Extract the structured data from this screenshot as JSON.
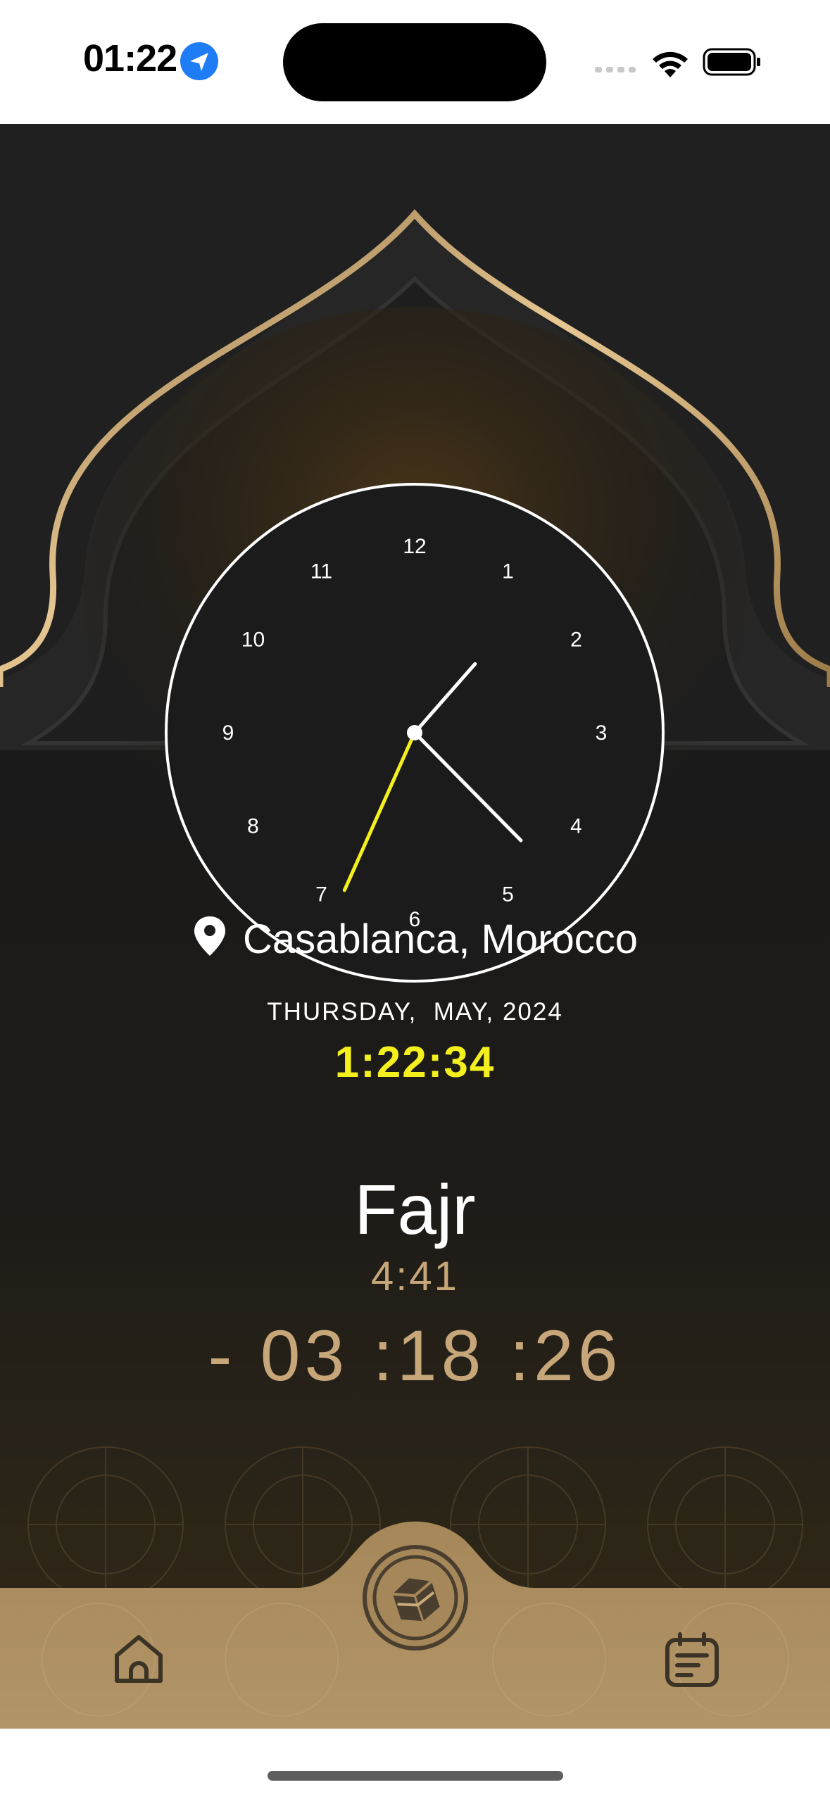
{
  "status_bar": {
    "time": "01:22",
    "icons": [
      "location-arrow-icon",
      "cellular-signal-icon",
      "wifi-icon",
      "battery-icon"
    ]
  },
  "clock": {
    "numerals": [
      "12",
      "1",
      "2",
      "3",
      "4",
      "5",
      "6",
      "7",
      "8",
      "9",
      "10",
      "11"
    ],
    "hour": 1,
    "minute": 22,
    "second": 34,
    "second_hand_color": "#f4f01e",
    "face_color": "#1b1b1b",
    "ring_color": "#ffffff"
  },
  "location": {
    "icon": "map-pin-icon",
    "label": "Casablanca, Morocco"
  },
  "date_line": "THURSDAY,  MAY, 2024",
  "current_time": "1:22:34",
  "next_prayer": {
    "name": "Fajr",
    "time": "4:41",
    "countdown": "- 03 :18 :26"
  },
  "bottom_nav": {
    "items": [
      {
        "icon": "home-icon"
      },
      {
        "icon": "kaaba-qibla-icon"
      },
      {
        "icon": "calendar-icon"
      }
    ]
  },
  "colors": {
    "accent_gold": "#c7a77a",
    "nav_bar": "#a98a5e",
    "background": "#202020",
    "highlight_yellow": "#f4f01e"
  }
}
